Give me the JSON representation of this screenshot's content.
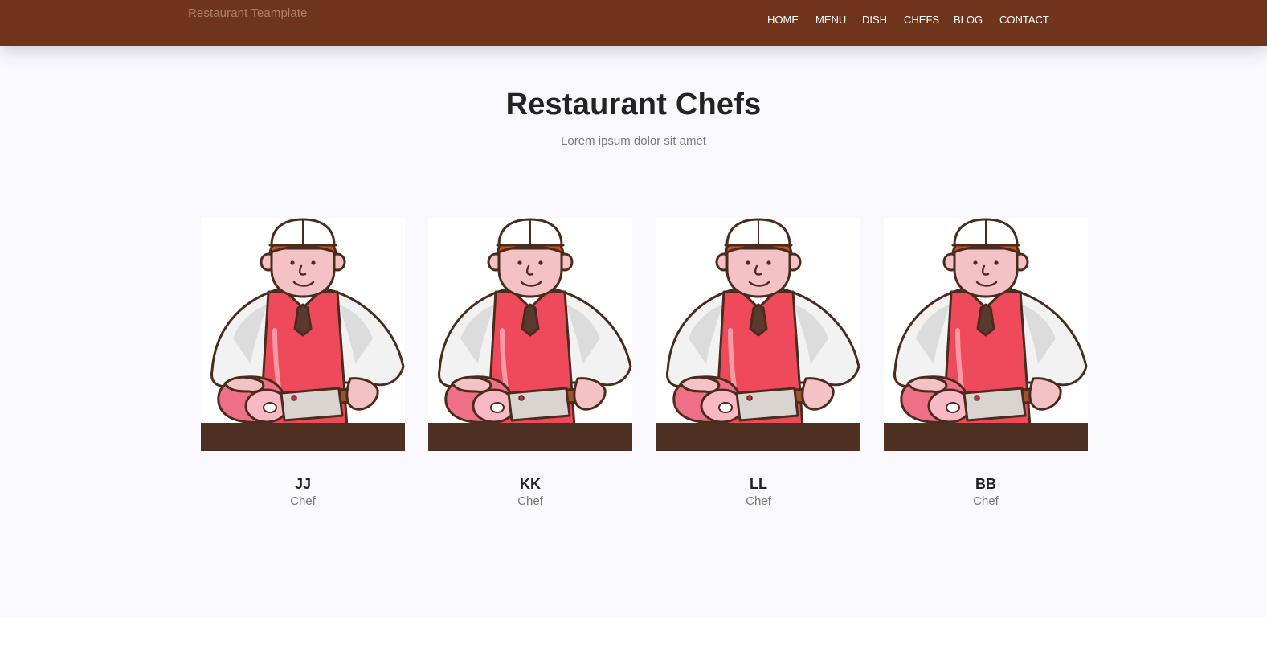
{
  "brand": "Restaurant Teamplate",
  "nav": {
    "home": "HOME",
    "menu": "MENU",
    "dish": "DISH",
    "chefs": "CHEFS",
    "blog": "BLOG",
    "contact": "CONTACT"
  },
  "section": {
    "title": "Restaurant Chefs",
    "subtitle": "Lorem ipsum dolor sit amet"
  },
  "chefs": [
    {
      "name": "JJ",
      "role": "Chef",
      "image": "butcher-chef-cartoon"
    },
    {
      "name": "KK",
      "role": "Chef",
      "image": "butcher-chef-cartoon"
    },
    {
      "name": "LL",
      "role": "Chef",
      "image": "butcher-chef-cartoon"
    },
    {
      "name": "BB",
      "role": "Chef",
      "image": "butcher-chef-cartoon"
    }
  ],
  "colors": {
    "navbar": "#6e351c",
    "section_background": "#f9f9fd",
    "apron": "#ef4a5c",
    "counter": "#4d3022",
    "heading": "#232323",
    "muted_text": "#7a7a7a"
  }
}
